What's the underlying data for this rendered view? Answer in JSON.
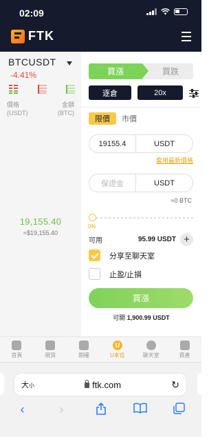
{
  "status_bar": {
    "time": "02:09"
  },
  "header": {
    "brand": "FTK"
  },
  "market": {
    "pair": "BTCUSDT",
    "change": "-4.41%",
    "col_price_label": "價格",
    "col_price_unit": "(USDT)",
    "col_amount_label": "金額",
    "col_amount_unit": "(BTC)",
    "last_price": "19,155.40",
    "last_price_usd": "≈$19,155.40"
  },
  "order": {
    "buy_tab": "買漲",
    "sell_tab": "買跌",
    "margin_mode": "逐倉",
    "leverage": "20x",
    "type_limit": "限價",
    "type_market": "市價",
    "price_value": "19155.4",
    "price_unit": "USDT",
    "use_latest_price": "套用最新價格",
    "margin_placeholder": "保證金",
    "margin_unit": "USDT",
    "btc_estimate": "≈0 BTC",
    "slider_percent": "0%",
    "slider_fraction": 0,
    "available_label": "可用",
    "available_value": "95.99 USDT",
    "share_chat_label": "分享至聊天室",
    "share_chat_checked": true,
    "tpsl_label": "止盈/止損",
    "tpsl_checked": false,
    "submit_label": "買漲",
    "openable_label": "可開",
    "openable_value": "1,900.99 USDT"
  },
  "bottom_nav": {
    "items": [
      {
        "label": "首頁",
        "icon": "home-icon"
      },
      {
        "label": "現貨",
        "icon": "spot-chart-icon"
      },
      {
        "label": "期權",
        "icon": "options-chart-icon"
      },
      {
        "label": "U本位",
        "icon": "usdt-futures-icon",
        "glyph": "U",
        "active": true
      },
      {
        "label": "聊天室",
        "icon": "chat-icon"
      },
      {
        "label": "資產",
        "icon": "wallet-icon"
      }
    ]
  },
  "browser": {
    "text_size_label": "大",
    "text_size_small": "小",
    "url": "ftk.com"
  },
  "colors": {
    "header_bg": "#151a2c",
    "buy_green": "#7dd35a",
    "sell_red": "#e8463f",
    "accent_yellow": "#f7c948"
  }
}
